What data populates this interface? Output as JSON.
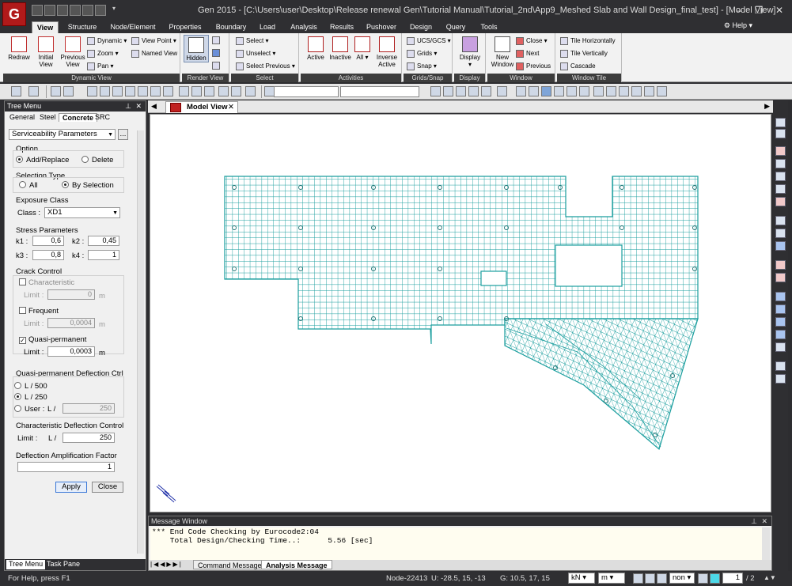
{
  "app": {
    "title": "Gen 2015 - [C:\\Users\\user\\Desktop\\Release renewal Gen\\Tutorial Manual\\Tutorial_2nd\\App9_Meshed Slab and Wall Design_final_test] - [Model View]",
    "logo_text": "G"
  },
  "menu": {
    "tabs": [
      "View",
      "Structure",
      "Node/Element",
      "Properties",
      "Boundary",
      "Load",
      "Analysis",
      "Results",
      "Pushover",
      "Design",
      "Query",
      "Tools"
    ],
    "active": "View",
    "help": "Help"
  },
  "ribbon": {
    "groups": {
      "dynamic_view": "Dynamic View",
      "render_view": "Render View",
      "select": "Select",
      "activities": "Activities",
      "grids_snap": "Grids/Snap",
      "display": "Display",
      "window": "Window",
      "window_tile": "Window Tile"
    },
    "redraw": "Redraw",
    "initial_view_1": "Initial",
    "initial_view_2": "View",
    "previous_view_1": "Previous",
    "previous_view_2": "View",
    "dynamic": "Dynamic",
    "zoom": "Zoom",
    "pan": "Pan",
    "view_point": "View Point",
    "named_view": "Named View",
    "hidden": "Hidden",
    "select": "Select",
    "unselect": "Unselect",
    "select_previous": "Select Previous",
    "active": "Active",
    "inactive": "Inactive",
    "all": "All",
    "inverse_1": "Inverse",
    "inverse_2": "Active",
    "ucs_gcs": "UCS/GCS",
    "grids": "Grids",
    "snap": "Snap",
    "display": "Display",
    "new_window_1": "New",
    "new_window_2": "Window",
    "close": "Close",
    "next": "Next",
    "previous": "Previous",
    "tile_horizontally": "Tile Horizontally",
    "tile_vertically": "Tile Vertically",
    "cascade": "Cascade"
  },
  "tree_menu": {
    "title": "Tree Menu",
    "tabs": [
      "General",
      "Steel",
      "Concrete",
      "SRC"
    ],
    "active_tab": "Concrete",
    "function_select": "Serviceability Parameters",
    "option": {
      "label": "Option",
      "add_replace": "Add/Replace",
      "delete": "Delete",
      "selected": "Add/Replace"
    },
    "selection_type": {
      "label": "Selection Type",
      "all": "All",
      "by_selection": "By Selection",
      "selected": "By Selection"
    },
    "exposure_class": {
      "label": "Exposure Class",
      "class_label": "Class :",
      "value": "XD1"
    },
    "stress": {
      "label": "Stress Parameters",
      "k1_label": "k1 :",
      "k1": "0,6",
      "k2_label": "k2 :",
      "k2": "0,45",
      "k3_label": "k3 :",
      "k3": "0,8",
      "k4_label": "k4 :",
      "k4": "1"
    },
    "crack_control": {
      "label": "Crack Control",
      "characteristic": "Characteristic",
      "characteristic_checked": false,
      "char_limit_label": "Limit :",
      "char_limit": "0",
      "char_unit": "m",
      "frequent": "Frequent",
      "frequent_checked": false,
      "freq_limit_label": "Limit :",
      "freq_limit": "0,0004",
      "freq_unit": "m",
      "quasi": "Quasi-permanent",
      "quasi_checked": true,
      "quasi_limit_label": "Limit :",
      "quasi_limit": "0,0003",
      "quasi_unit": "m"
    },
    "quasi_deflection": {
      "label": "Quasi-permanent Deflection Ctrl",
      "l500": "L / 500",
      "l250": "L / 250",
      "user": "User :",
      "user_l": "L /",
      "user_value": "250",
      "selected": "L / 250"
    },
    "char_deflection": {
      "label": "Characteristic Deflection Control",
      "limit_label": "Limit :",
      "l_label": "L /",
      "value": "250"
    },
    "amplification": {
      "label": "Deflection Amplification Factor",
      "value": "1"
    },
    "apply": "Apply",
    "close": "Close",
    "bottom_tabs": [
      "Tree Menu",
      "Task Pane"
    ]
  },
  "model_view": {
    "tab_label": "Model View"
  },
  "message_window": {
    "title": "Message Window",
    "lines": [
      "*** End Code Checking by Eurocode2:04",
      "    Total Design/Checking Time..:      5.56 [sec]"
    ],
    "tabs": [
      "Command Message",
      "Analysis Message"
    ],
    "active_tab": "Analysis Message"
  },
  "status_bar": {
    "help": "For Help, press F1",
    "node": "Node-22413",
    "u_coords": "U: -28.5, 15, -13",
    "g_coords": "G: 10.5, 17, 15",
    "force_unit": "kN",
    "length_unit": "m",
    "snap": "non",
    "page_current": "1",
    "page_total": "/ 2"
  },
  "colors": {
    "mesh": "#1a9e9e",
    "dark_chrome": "#2f2f32",
    "ribbon_bg": "#f2f2f2"
  }
}
